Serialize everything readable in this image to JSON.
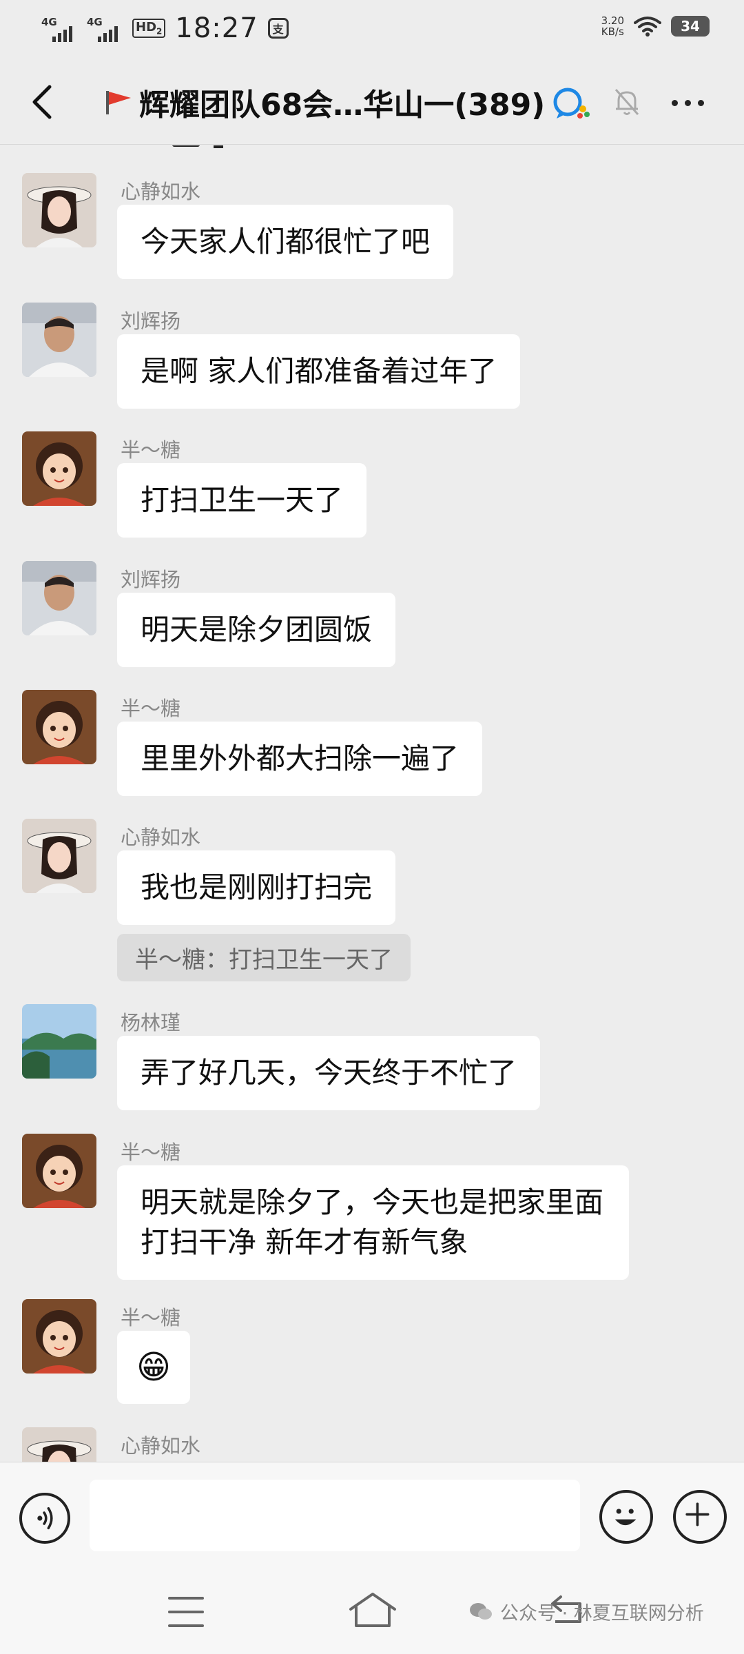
{
  "status_bar": {
    "network_1": "4G",
    "network_2": "4G",
    "hd_badge": "HD",
    "hd_sub": "2",
    "time": "18:27",
    "speed_value": "3.20",
    "speed_unit": "KB/s",
    "battery": "34"
  },
  "header": {
    "title": "辉耀团队68会…华山一(389)"
  },
  "messages": [
    {
      "sender": "心静如水",
      "text": "今天家人们都很忙了吧"
    },
    {
      "sender": "刘辉扬",
      "text": "是啊  家人们都准备着过年了"
    },
    {
      "sender": "半～糖",
      "text": "打扫卫生一天了"
    },
    {
      "sender": "刘辉扬",
      "text": "明天是除夕团圆饭"
    },
    {
      "sender": "半～糖",
      "text": "里里外外都大扫除一遍了"
    },
    {
      "sender": "心静如水",
      "text": "我也是刚刚打扫完",
      "quote": "半～糖：打扫卫生一天了"
    },
    {
      "sender": "杨林瑾",
      "text": "弄了好几天，今天终于不忙了"
    },
    {
      "sender": "半～糖",
      "text": "明天就是除夕了，今天也是把家里面打扫干净 新年才有新气象"
    },
    {
      "sender": "半～糖",
      "text": "😁"
    },
    {
      "sender": "心静如水"
    }
  ],
  "watermark": {
    "text": "公众号 · 林夏互联网分析"
  }
}
